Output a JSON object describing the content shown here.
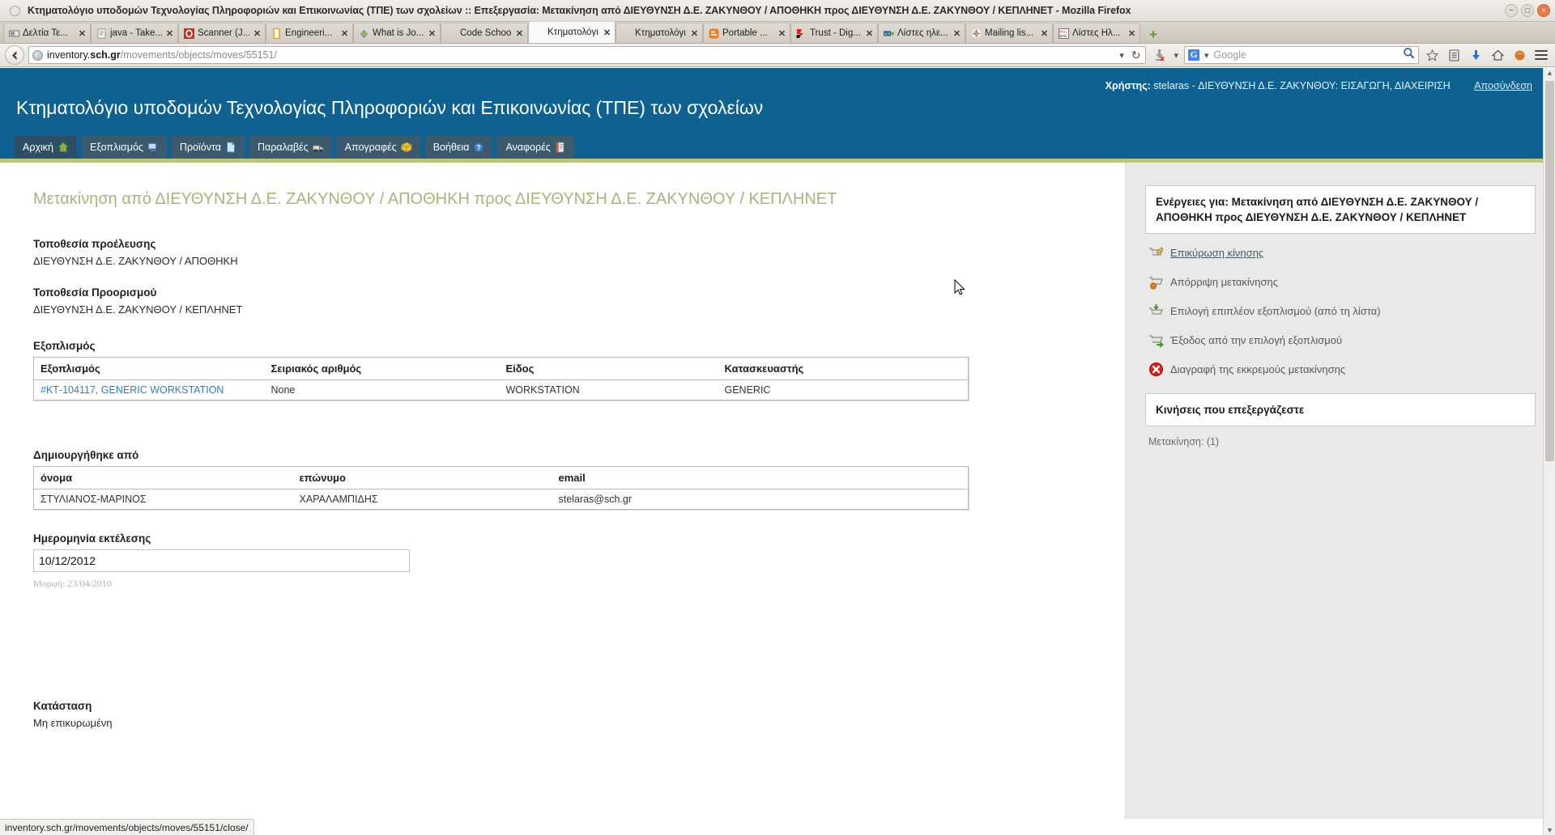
{
  "window": {
    "title": "Κτηματολόγιο υποδομών Τεχνολογίας Πληροφοριών και Επικοινωνίας (ΤΠΕ) των σχολείων :: Επεξεργασία: Μετακίνηση από ΔΙΕΥΘΥΝΣΗ Δ.Ε. ΖΑΚΥΝΘΟΥ / ΑΠΟΘΗΚΗ προς ΔΙΕΥΘΥΝΣΗ Δ.Ε. ΖΑΚΥΝΘΟΥ / ΚΕΠΛΗΝΕΤ - Mozilla Firefox",
    "minimize": "−",
    "maximize": "□",
    "close": "×"
  },
  "tabs": [
    {
      "label": "Δελτία Τε...",
      "icon": "news-icon",
      "close": "✕",
      "active": false
    },
    {
      "label": "java - Take...",
      "icon": "java-icon",
      "close": "✕",
      "active": false
    },
    {
      "label": "Scanner (J...",
      "icon": "scanner-icon",
      "close": "✕",
      "active": false
    },
    {
      "label": "Engineeri...",
      "icon": "doc-icon",
      "close": "✕",
      "active": false
    },
    {
      "label": "What is Jo...",
      "icon": "joomla-icon",
      "close": "✕",
      "active": false
    },
    {
      "label": "Code School -...",
      "icon": "codeschool-icon",
      "close": "✕",
      "active": false
    },
    {
      "label": "Κτηματολόγι...",
      "icon": "inventory-icon",
      "close": "✕",
      "active": true
    },
    {
      "label": "Κτηματολόγι...",
      "icon": "inventory-icon",
      "close": "✕",
      "active": false
    },
    {
      "label": "Portable ...",
      "icon": "blogger-icon",
      "close": "✕",
      "active": false
    },
    {
      "label": "Trust - Dig...",
      "icon": "trust-icon",
      "close": "✕",
      "active": false
    },
    {
      "label": "Λίστες ηλε...",
      "icon": "sch-icon",
      "close": "✕",
      "active": false
    },
    {
      "label": "Mailing lis...",
      "icon": "mail-icon",
      "close": "✕",
      "active": false
    },
    {
      "label": "Λίστες Ηλ...",
      "icon": "mailman-icon",
      "close": "✕",
      "active": false
    }
  ],
  "newtab_label": "+",
  "navbar": {
    "back_icon": "back-arrow-icon",
    "url_prefix": "inventory.",
    "url_domain": "sch.gr",
    "url_path": "/movements/objects/moves/55151/",
    "dropdown_marker": "▾",
    "reload_icon": "↻",
    "download_icon": "download-icon",
    "download_caret": "▾",
    "search_engine": "Google",
    "search_caret": "▾",
    "search_icon": "search-magnifier-icon",
    "bookmark_icon": "star-icon",
    "reader_icon": "reader-list-icon",
    "downloads_icon": "downloads-arrow-icon",
    "home_icon": "home-icon",
    "firefox_icon": "firefox-icon",
    "menu_icon": "hamburger-menu-icon"
  },
  "site": {
    "user_label": "Χρήστης:",
    "user_info": "stelaras - ΔΙΕΥΘΥΝΣΗ Δ.Ε. ΖΑΚΥΝΘΟΥ: ΕΙΣΑΓΩΓΗ, ΔΙΑΧΕΙΡΙΣΗ",
    "logout": "Αποσύνδεση",
    "title": "Κτηματολόγιο υποδομών Τεχνολογίας Πληροφοριών και Επικοινωνίας (ΤΠΕ) των σχολείων"
  },
  "navtabs": [
    {
      "label": "Αρχική",
      "icon": "home-icon"
    },
    {
      "label": "Εξοπλισμός",
      "icon": "computer-icon"
    },
    {
      "label": "Προϊόντα",
      "icon": "page-icon"
    },
    {
      "label": "Παραλαβές",
      "icon": "truck-icon"
    },
    {
      "label": "Απογραφές",
      "icon": "box-icon"
    },
    {
      "label": "Βοήθεια",
      "icon": "question-icon"
    },
    {
      "label": "Αναφορές",
      "icon": "report-icon"
    }
  ],
  "main": {
    "page_title": "Μετακίνηση από ΔΙΕΥΘΥΝΣΗ Δ.Ε. ΖΑΚΥΝΘΟΥ / ΑΠΟΘΗΚΗ προς ΔΙΕΥΘΥΝΣΗ Δ.Ε. ΖΑΚΥΝΘΟΥ / ΚΕΠΛΗΝΕΤ",
    "origin_label": "Τοποθεσία προέλευσης",
    "origin_value": "ΔΙΕΥΘΥΝΣΗ Δ.Ε. ΖΑΚΥΝΘΟΥ / ΑΠΟΘΗΚΗ",
    "destination_label": "Τοποθεσία Προορισμού",
    "destination_value": "ΔΙΕΥΘΥΝΣΗ Δ.Ε. ΖΑΚΥΝΘΟΥ / ΚΕΠΛΗΝΕΤ",
    "equipment_label": "Εξοπλισμός",
    "equipment_headers": [
      "Εξοπλισμός",
      "Σειριακός αριθμός",
      "Είδος",
      "Κατασκευαστής"
    ],
    "equipment_rows": [
      {
        "name": "#ΚΤ-104117, GENERIC WORKSTATION",
        "serial": "None",
        "kind": "WORKSTATION",
        "maker": "GENERIC"
      }
    ],
    "creator_label": "Δημιουργήθηκε από",
    "creator_headers": [
      "όνομα",
      "επώνυμο",
      "email"
    ],
    "creator_rows": [
      {
        "first": "ΣΤΥΛΙΑΝΟΣ-ΜΑΡΙΝΟΣ",
        "last": "ΧΑΡΑΛΑΜΠΙΔΗΣ",
        "email": "stelaras@sch.gr"
      }
    ],
    "date_label": "Ημερομηνία εκτέλεσης",
    "date_value": "10/12/2012",
    "date_format_hint": "Μορφή: 23/04/2010",
    "status_label": "Κατάσταση",
    "status_value": "Μη επικυρωμένη"
  },
  "sidebar": {
    "actions_panel_title": "Ενέργειες για: Μετακίνηση από ΔΙΕΥΘΥΝΣΗ Δ.Ε. ΖΑΚΥΝΘΟΥ / ΑΠΟΘΗΚΗ προς ΔΙΕΥΘΥΝΣΗ Δ.Ε. ΖΑΚΥΝΘΟΥ / ΚΕΠΛΗΝΕΤ",
    "actions": [
      {
        "label": "Επικύρωση κίνησης",
        "icon": "cart-edit-icon",
        "link": true
      },
      {
        "label": "Απόρριψη μετακίνησης",
        "icon": "cart-reject-icon",
        "link": false
      },
      {
        "label": "Επιλογή επιπλέον εξοπλισμού (από τη λίστα)",
        "icon": "cart-add-icon",
        "link": false
      },
      {
        "label": "Έξοδος από την επιλογή εξοπλισμού",
        "icon": "cart-exit-icon",
        "link": false
      },
      {
        "label": "Διαγραφή της εκκρεμούς μετακίνησης",
        "icon": "delete-red-icon",
        "link": false
      }
    ],
    "moves_panel_title": "Κινήσεις που επεξεργάζεστε",
    "moves_item": "Μετακίνηση: (1)"
  },
  "statusbar": {
    "text": "inventory.sch.gr/movements/objects/moves/55151/close/"
  },
  "colors": {
    "header_blue": "#0e6191",
    "accent_green": "#b8c77a",
    "title_olive": "#a9b47a",
    "link_blue": "#2c7fc4"
  }
}
